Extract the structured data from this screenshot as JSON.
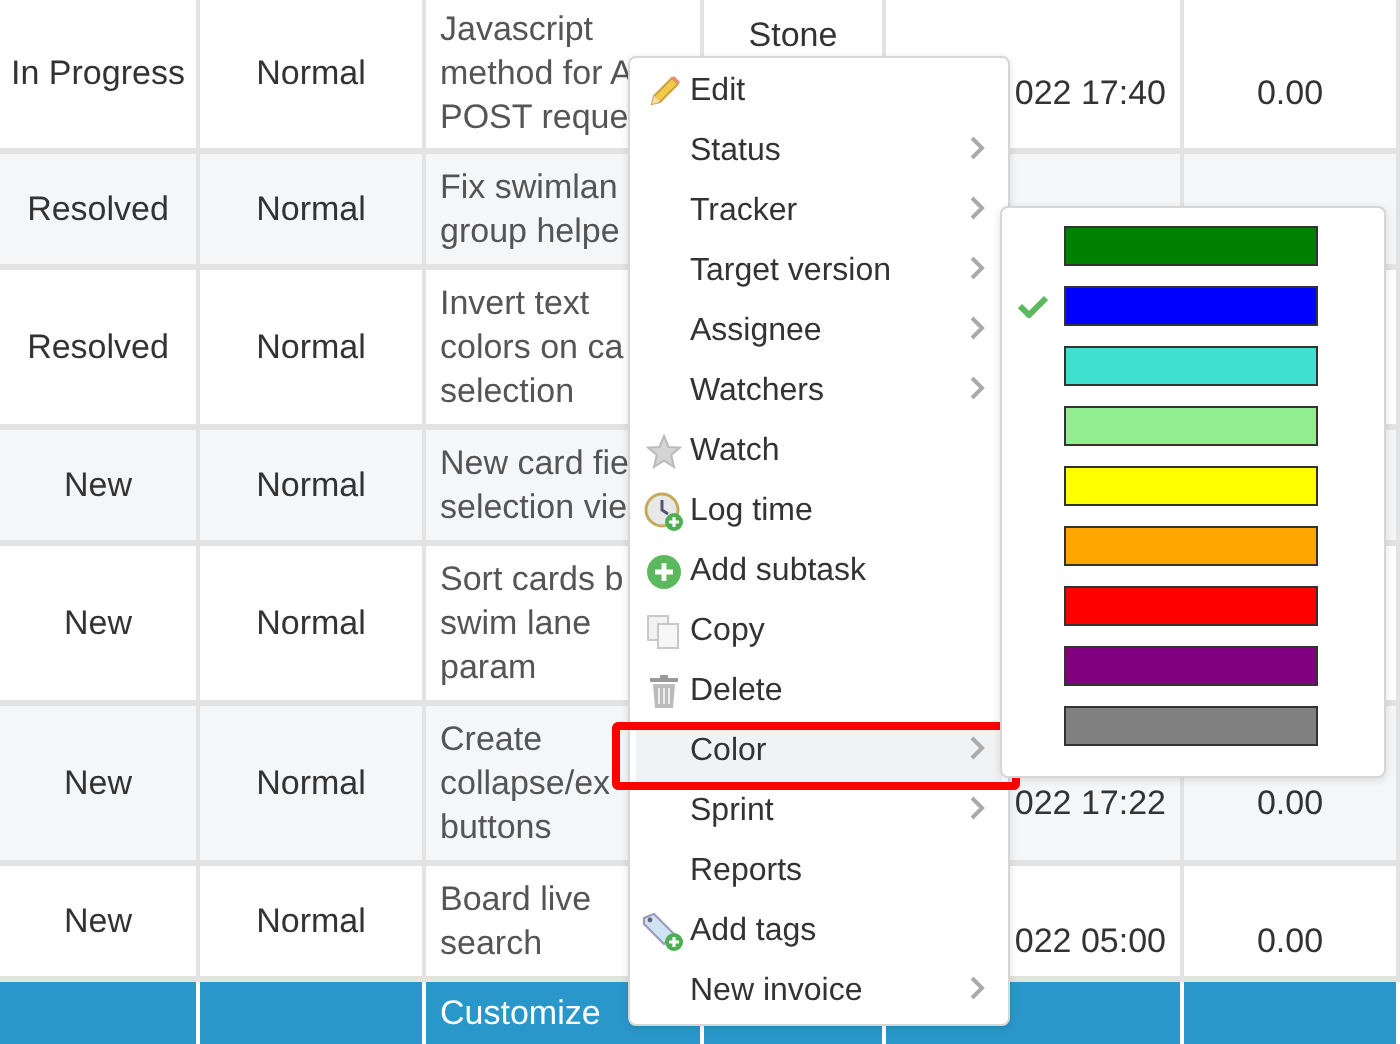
{
  "table": {
    "rows": [
      {
        "status": "In Progress",
        "priority": "Normal",
        "subject_lines": [
          "Javascript",
          "method for A",
          "POST reque"
        ],
        "column_4": "Stone",
        "column_5": "022 17:40",
        "column_6": "0.00"
      },
      {
        "status": "Resolved",
        "priority": "Normal",
        "subject_lines": [
          "Fix swimlan",
          "group helpe"
        ]
      },
      {
        "status": "Resolved",
        "priority": "Normal",
        "subject_lines": [
          "Invert text",
          "colors on ca",
          "selection"
        ]
      },
      {
        "status": "New",
        "priority": "Normal",
        "subject_lines": [
          "New card fie",
          "selection vie"
        ]
      },
      {
        "status": "New",
        "priority": "Normal",
        "subject_lines": [
          "Sort cards b",
          "swim lane",
          "param"
        ]
      },
      {
        "status": "New",
        "priority": "Normal",
        "subject_lines": [
          "Create",
          "collapse/ex",
          "buttons"
        ],
        "column_5": "022 17:22",
        "column_6": "0.00"
      },
      {
        "status": "New",
        "priority": "Normal",
        "subject_lines": [
          "Board live",
          "search"
        ],
        "column_5": "022 05:00",
        "column_6": "0.00"
      }
    ],
    "footer": {
      "label": "Customize"
    }
  },
  "context_menu": {
    "items": [
      {
        "label": "Edit",
        "kind": "edit",
        "submenu": false,
        "selected": false,
        "framed": false
      },
      {
        "label": "Status",
        "kind": "plain",
        "submenu": true,
        "selected": false,
        "framed": false
      },
      {
        "label": "Tracker",
        "kind": "plain",
        "submenu": true,
        "selected": false,
        "framed": false
      },
      {
        "label": "Target version",
        "kind": "plain",
        "submenu": true,
        "selected": false,
        "framed": false
      },
      {
        "label": "Assignee",
        "kind": "plain",
        "submenu": true,
        "selected": false,
        "framed": false
      },
      {
        "label": "Watchers",
        "kind": "plain",
        "submenu": true,
        "selected": false,
        "framed": false
      },
      {
        "label": "Watch",
        "kind": "watch",
        "submenu": false,
        "selected": false,
        "framed": false
      },
      {
        "label": "Log time",
        "kind": "log-time",
        "submenu": false,
        "selected": false,
        "framed": false
      },
      {
        "label": "Add subtask",
        "kind": "add",
        "submenu": false,
        "selected": false,
        "framed": false
      },
      {
        "label": "Copy",
        "kind": "copy",
        "submenu": false,
        "selected": false,
        "framed": false
      },
      {
        "label": "Delete",
        "kind": "delete",
        "submenu": false,
        "selected": false,
        "framed": false
      },
      {
        "label": "Color",
        "kind": "plain",
        "submenu": true,
        "selected": true,
        "framed": true
      },
      {
        "label": "Sprint",
        "kind": "plain",
        "submenu": true,
        "selected": false,
        "framed": false
      },
      {
        "label": "Reports",
        "kind": "plain",
        "submenu": false,
        "selected": false,
        "framed": false
      },
      {
        "label": "Add tags",
        "kind": "tags",
        "submenu": false,
        "selected": false,
        "framed": false
      },
      {
        "label": "New invoice",
        "kind": "plain",
        "submenu": true,
        "selected": false,
        "framed": false
      }
    ]
  },
  "color_submenu": {
    "swatches": [
      {
        "color": "#008000",
        "selected": false
      },
      {
        "color": "#0000ff",
        "selected": true
      },
      {
        "color": "#40e0d0",
        "selected": false
      },
      {
        "color": "#90ee90",
        "selected": false
      },
      {
        "color": "#ffff00",
        "selected": false
      },
      {
        "color": "#ffa500",
        "selected": false
      },
      {
        "color": "#ff0000",
        "selected": false
      },
      {
        "color": "#800080",
        "selected": false
      },
      {
        "color": "#808080",
        "selected": false
      }
    ]
  }
}
